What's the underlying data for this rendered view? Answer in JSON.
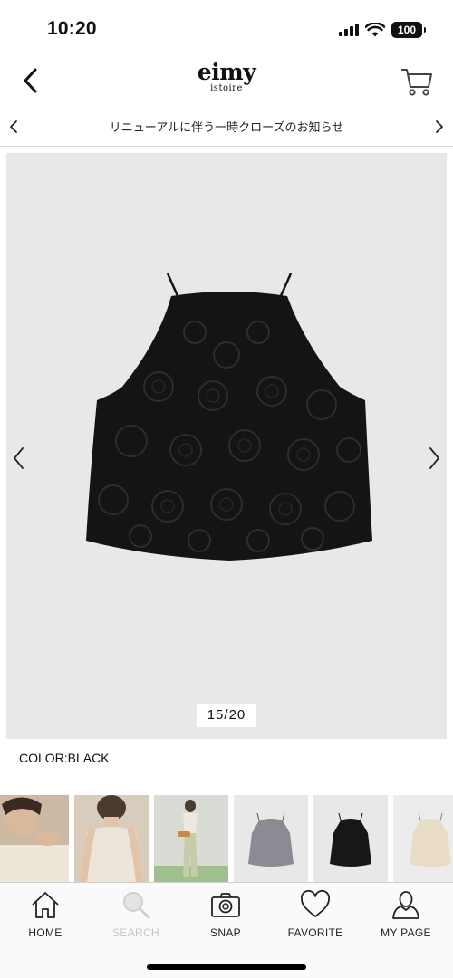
{
  "status_bar": {
    "time": "10:20",
    "battery": "100"
  },
  "header": {
    "logo_main": "eimy",
    "logo_sub": "istoire"
  },
  "announcement": {
    "text": "リニューアルに伴う一時クローズのお知らせ"
  },
  "gallery": {
    "counter": "15/20",
    "background": "#e8e8e8"
  },
  "product": {
    "color_label": "COLOR:BLACK"
  },
  "thumbnails": [
    {
      "name": "model-closeup-white"
    },
    {
      "name": "model-back-white"
    },
    {
      "name": "model-full-body"
    },
    {
      "name": "top-grey"
    },
    {
      "name": "top-black"
    },
    {
      "name": "top-ivory"
    }
  ],
  "bottom_nav": {
    "home": "HOME",
    "search": "SEARCH",
    "snap": "SNAP",
    "favorite": "FAVORITE",
    "my_page": "MY PAGE"
  }
}
